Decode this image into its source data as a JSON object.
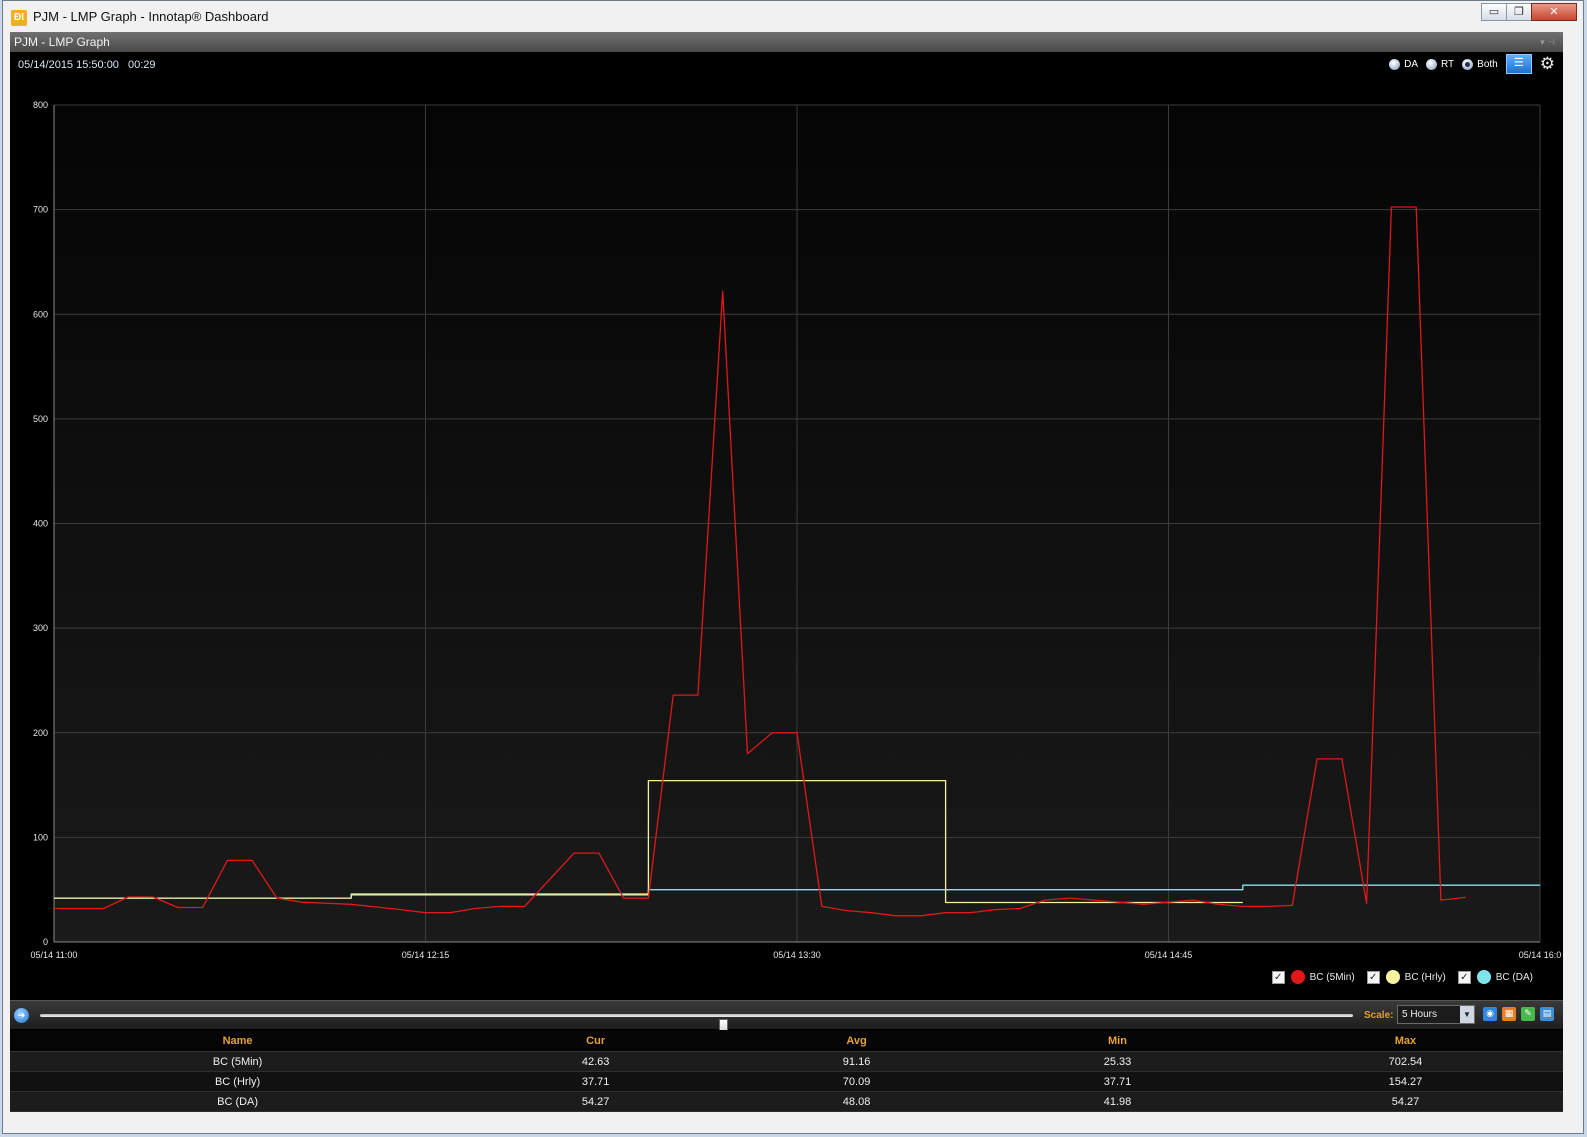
{
  "window": {
    "title": "PJM - LMP Graph - Innotap® Dashboard",
    "icon_name": "app-icon",
    "icon_glyph": "ÐI",
    "controls": {
      "minimize": "▭",
      "maximize": "❐",
      "close": "✕"
    }
  },
  "panel": {
    "title": "PJM - LMP Graph",
    "timestamp": "05/14/2015 15:50:00",
    "elapsed": "00:29"
  },
  "toolbar": {
    "options": [
      {
        "label": "DA",
        "selected": false
      },
      {
        "label": "RT",
        "selected": false
      },
      {
        "label": "Both",
        "selected": true
      }
    ],
    "list_icon": "☰",
    "gear_icon": "⚙"
  },
  "chart_data": {
    "type": "line",
    "title": "",
    "xlabel": "",
    "ylabel": "",
    "ylim": [
      0,
      800
    ],
    "yticks": [
      0,
      100,
      200,
      300,
      400,
      500,
      600,
      700,
      800
    ],
    "xlim": [
      "05/14 11:00",
      "05/14 16:00"
    ],
    "xtick_labels": [
      "05/14 11:00",
      "05/14 12:15",
      "05/14 13:30",
      "05/14 14:45",
      "05/14 16:0"
    ],
    "grid": true,
    "series": [
      {
        "name": "BC (5Min)",
        "color": "#e01818",
        "points": [
          [
            "11:00",
            32
          ],
          [
            "11:10",
            32
          ],
          [
            "11:15",
            43
          ],
          [
            "11:20",
            43
          ],
          [
            "11:25",
            33
          ],
          [
            "11:30",
            33
          ],
          [
            "11:35",
            78
          ],
          [
            "11:40",
            78
          ],
          [
            "11:45",
            42
          ],
          [
            "11:50",
            38
          ],
          [
            "12:00",
            36
          ],
          [
            "12:10",
            31
          ],
          [
            "12:15",
            28
          ],
          [
            "12:20",
            28
          ],
          [
            "12:25",
            32
          ],
          [
            "12:30",
            34
          ],
          [
            "12:35",
            34
          ],
          [
            "12:45",
            85
          ],
          [
            "12:50",
            85
          ],
          [
            "12:55",
            42
          ],
          [
            "13:00",
            42
          ],
          [
            "13:05",
            236
          ],
          [
            "13:10",
            236
          ],
          [
            "13:15",
            622
          ],
          [
            "13:20",
            180
          ],
          [
            "13:25",
            200
          ],
          [
            "13:30",
            200
          ],
          [
            "13:35",
            34
          ],
          [
            "13:40",
            30
          ],
          [
            "13:45",
            28
          ],
          [
            "13:50",
            25
          ],
          [
            "13:55",
            25
          ],
          [
            "14:00",
            28
          ],
          [
            "14:05",
            28
          ],
          [
            "14:10",
            31
          ],
          [
            "14:15",
            32
          ],
          [
            "14:20",
            40
          ],
          [
            "14:25",
            42
          ],
          [
            "14:30",
            40
          ],
          [
            "14:35",
            38
          ],
          [
            "14:40",
            36
          ],
          [
            "14:45",
            38
          ],
          [
            "14:50",
            40
          ],
          [
            "14:55",
            36
          ],
          [
            "15:00",
            34
          ],
          [
            "15:05",
            34
          ],
          [
            "15:10",
            35
          ],
          [
            "15:15",
            175
          ],
          [
            "15:20",
            175
          ],
          [
            "15:25",
            37
          ],
          [
            "15:30",
            702.54
          ],
          [
            "15:35",
            702.54
          ],
          [
            "15:40",
            40
          ],
          [
            "15:45",
            42.63
          ]
        ]
      },
      {
        "name": "BC (Hrly)",
        "color": "#f7f2a0",
        "points": [
          [
            "11:00",
            42
          ],
          [
            "12:00",
            42
          ],
          [
            "12:00",
            45
          ],
          [
            "13:00",
            45
          ],
          [
            "13:00",
            154.27
          ],
          [
            "14:00",
            154.27
          ],
          [
            "14:00",
            37.71
          ],
          [
            "15:00",
            37.71
          ]
        ]
      },
      {
        "name": "BC (DA)",
        "color": "#7fe4ec",
        "points": [
          [
            "11:00",
            42
          ],
          [
            "12:00",
            42
          ],
          [
            "12:00",
            46
          ],
          [
            "13:00",
            46
          ],
          [
            "13:00",
            50
          ],
          [
            "15:00",
            50
          ],
          [
            "15:00",
            54.27
          ],
          [
            "16:00",
            54.27
          ]
        ]
      }
    ]
  },
  "legend": [
    {
      "label": "BC (5Min)",
      "color": "#e01818",
      "checked": true
    },
    {
      "label": "BC (Hrly)",
      "color": "#f7f2a0",
      "checked": true
    },
    {
      "label": "BC (DA)",
      "color": "#7fe4ec",
      "checked": true
    }
  ],
  "slider": {
    "scale_label": "Scale:",
    "scale_value": "5 Hours",
    "position": 0.52,
    "play_icon": "➜",
    "tools": [
      "eye-icon",
      "grid-icon",
      "edit-icon",
      "save-icon"
    ]
  },
  "stats": {
    "headers": [
      "Name",
      "Cur",
      "Avg",
      "Min",
      "Max"
    ],
    "rows": [
      [
        "BC (5Min)",
        "42.63",
        "91.16",
        "25.33",
        "702.54"
      ],
      [
        "BC (Hrly)",
        "37.71",
        "70.09",
        "37.71",
        "154.27"
      ],
      [
        "BC (DA)",
        "54.27",
        "48.08",
        "41.98",
        "54.27"
      ]
    ]
  }
}
